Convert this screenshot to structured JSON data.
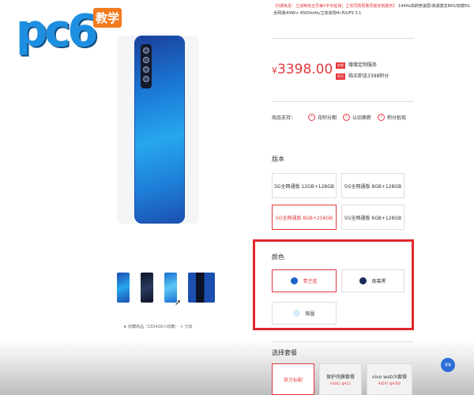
{
  "logo": {
    "main": "pc6",
    "badge": "教学"
  },
  "top_info": {
    "red_text": "【0期免息：立减等级全员每¥半年延保；立省同款限量原版定制服务】",
    "rest_text": "144Hz高刷竞速屏/高通骁龙865/双模5G全网通/44W+ 4500mAh/立体双扬Hi-Fi/UFS 3.1"
  },
  "price": {
    "currency": "¥",
    "amount": "3398.00"
  },
  "promos": [
    {
      "tag": "定制",
      "text": "赠赠定制服务"
    },
    {
      "tag": "积分",
      "text": "购买即送3398积分"
    }
  ],
  "support": {
    "label": "商品支持：",
    "items": [
      "花呗分期",
      "以旧换新",
      "积分抵现"
    ]
  },
  "version": {
    "title": "版本",
    "options": [
      {
        "label": "5G全网通版 12GB+128GB",
        "selected": false
      },
      {
        "label": "5G全网通版 8GB+128GB",
        "selected": false
      },
      {
        "label": "5G全网通版 8GB+256GB",
        "selected": true
      },
      {
        "label": "5G全网通版 6GB+128GB",
        "selected": false
      }
    ]
  },
  "color": {
    "title": "颜色",
    "options": [
      {
        "label": "青空蓝",
        "swatch": "#1e63c9",
        "selected": true
      },
      {
        "label": "夜幕黑",
        "swatch": "#1c2a5a",
        "selected": false
      },
      {
        "label": "极昼",
        "swatch": "#d6ebf7",
        "selected": false
      }
    ]
  },
  "gallery": {
    "favorites": "★ 收藏商品（155426人收藏）  < 分享"
  },
  "package": {
    "title": "选择套餐",
    "options": [
      {
        "label": "官方标配",
        "sub": "",
        "selected": true
      },
      {
        "label": "保护壳膜套餐",
        "sub": "¥3461  省¥15",
        "selected": false
      },
      {
        "label": "vivo watch套餐",
        "sub": "¥4597  省¥300",
        "selected": false
      }
    ]
  },
  "float_button": "客服",
  "colors": {
    "accent": "#e4393c",
    "highlight_box": "#e0262c",
    "phone_blue": "#27a6ee"
  }
}
